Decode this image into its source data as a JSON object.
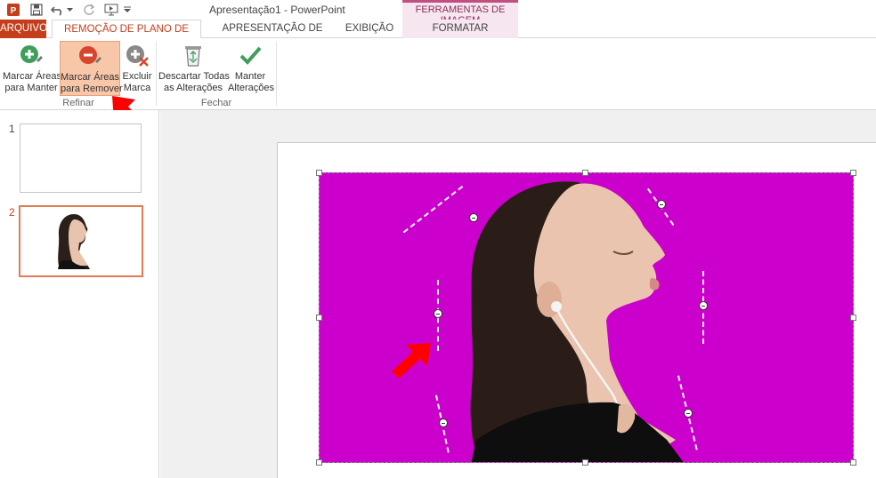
{
  "app": {
    "title": "Apresentação1 - PowerPoint",
    "context_group": "FERRAMENTAS DE IMAGEM",
    "quick_access": [
      "powerpoint-logo-icon",
      "save-icon",
      "undo-icon",
      "undo-dropdown-icon",
      "redo-icon",
      "start-from-beginning-icon",
      "customize-dropdown-icon"
    ]
  },
  "tabs": {
    "file": "ARQUIVO",
    "active": "REMOÇÃO DE PLANO DE FUNDO",
    "slideshow": "APRESENTAÇÃO DE SLIDES",
    "view": "EXIBIÇÃO",
    "format": "FORMATAR"
  },
  "ribbon": {
    "mark_keep": {
      "line1": "Marcar Áreas",
      "line2": "para Manter"
    },
    "mark_remove": {
      "line1": "Marcar Áreas",
      "line2": "para Remover"
    },
    "delete_mark": {
      "line1": "Excluir",
      "line2": "Marca"
    },
    "discard": {
      "line1": "Descartar Todas",
      "line2": "as Alterações"
    },
    "keep_changes": {
      "line1": "Manter",
      "line2": "Alterações"
    },
    "group_refine": "Refinar",
    "group_close": "Fechar"
  },
  "slides_panel": {
    "items": [
      {
        "number": "1",
        "selected": false
      },
      {
        "number": "2",
        "selected": true
      }
    ]
  },
  "colors": {
    "accent": "#c43e1c",
    "removal_overlay": "#cc00cc",
    "annotation_arrow": "#ff0000",
    "context_tab": "#f6e6ef"
  }
}
